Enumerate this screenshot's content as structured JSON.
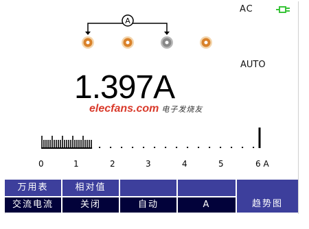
{
  "status": {
    "mode": "AC",
    "range_mode": "AUTO",
    "power_icon": "plug-icon",
    "power_color": "#39c439"
  },
  "jacks": {
    "count": 4,
    "active_index": 2,
    "selector_symbol": "A"
  },
  "reading": {
    "value": "1.397A"
  },
  "watermark": {
    "site": "elecfans.com",
    "cn": "电子发烧友"
  },
  "bargraph": {
    "fraction": 0.233,
    "max": 6,
    "unit": "A",
    "ticks": [
      "0",
      "1",
      "2",
      "3",
      "4",
      "5",
      "6 A"
    ]
  },
  "softkeys": [
    {
      "top": "万用表",
      "bottom": "交流电流"
    },
    {
      "top": "相对值",
      "bottom": "关闭"
    },
    {
      "top": "",
      "bottom": "自动"
    },
    {
      "top": "",
      "bottom": "A"
    },
    {
      "single": "趋势图"
    }
  ],
  "colors": {
    "softkey_top": "#3d3f9c",
    "softkey_bottom": "#02023a",
    "jack_active": "#888888",
    "jack_inactive": "#d9822b"
  }
}
